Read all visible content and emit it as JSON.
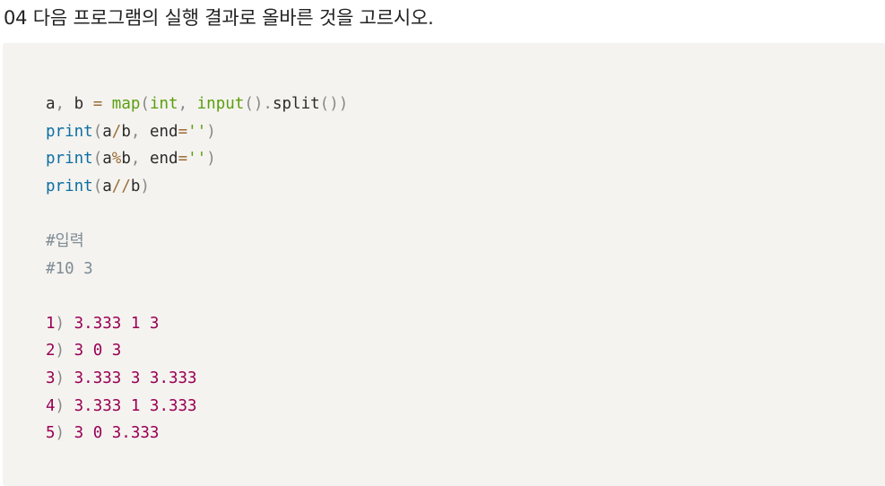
{
  "question": {
    "text": "04 다음 프로그램의 실행 결과로 올바른 것을 고르시오."
  },
  "code": {
    "line1": {
      "a": "a",
      "comma1": ",",
      "b": " b ",
      "eq": "=",
      "map": " map",
      "lp1": "(",
      "int": "int",
      "comma2": ",",
      "input": " input",
      "lp2": "(",
      "rp2": ")",
      "dot": ".",
      "split": "split",
      "lp3": "(",
      "rp3": "))"
    },
    "line2": {
      "print": "print",
      "lp": "(",
      "a": "a",
      "op": "/",
      "b": "b",
      "comma": ",",
      "end": " end",
      "eq": "=",
      "str": "''",
      "rp": ")"
    },
    "line3": {
      "print": "print",
      "lp": "(",
      "a": "a",
      "op": "%",
      "b": "b",
      "comma": ",",
      "end": " end",
      "eq": "=",
      "str": "''",
      "rp": ")"
    },
    "line4": {
      "print": "print",
      "lp": "(",
      "a": "a",
      "op": "//",
      "b": "b",
      "rp": ")"
    },
    "comment1": "#입력",
    "comment2": "#10 3",
    "options": [
      {
        "num": "1",
        "paren": ")",
        "text": " 3.333 1 3"
      },
      {
        "num": "2",
        "paren": ")",
        "text": " 3 0 3"
      },
      {
        "num": "3",
        "paren": ")",
        "text": " 3.333 3 3.333"
      },
      {
        "num": "4",
        "paren": ")",
        "text": " 3.333 1 3.333"
      },
      {
        "num": "5",
        "paren": ")",
        "text": " 3 0 3.333"
      }
    ]
  }
}
